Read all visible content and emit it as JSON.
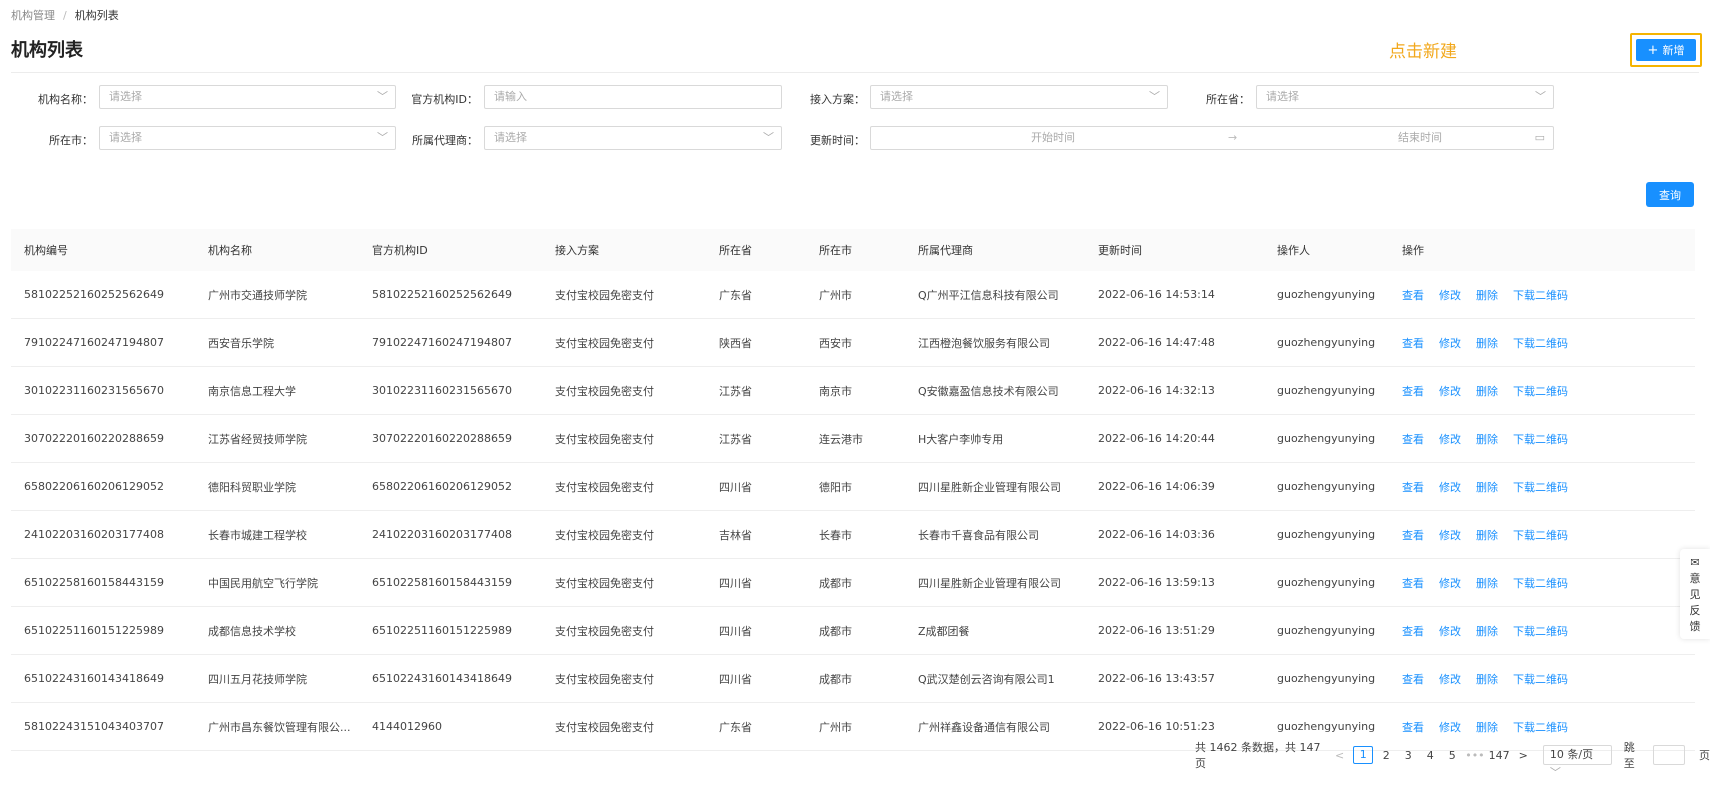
{
  "breadcrumb": {
    "parent": "机构管理",
    "separator": "/",
    "current": "机构列表"
  },
  "page_title": "机构列表",
  "hint_text": "点击新建",
  "add_button": "新增",
  "filters": {
    "org_name": {
      "label": "机构名称",
      "placeholder": "请选择"
    },
    "official_id": {
      "label": "官方机构ID",
      "placeholder": "请输入"
    },
    "access_plan": {
      "label": "接入方案",
      "placeholder": "请选择"
    },
    "province": {
      "label": "所在省",
      "placeholder": "请选择"
    },
    "city": {
      "label": "所在市",
      "placeholder": "请选择"
    },
    "agent": {
      "label": "所属代理商",
      "placeholder": "请选择"
    },
    "update_time": {
      "label": "更新时间",
      "start_placeholder": "开始时间",
      "end_placeholder": "结束时间",
      "separator": "→"
    }
  },
  "query_button": "查询",
  "table": {
    "columns": [
      "机构编号",
      "机构名称",
      "官方机构ID",
      "接入方案",
      "所在省",
      "所在市",
      "所属代理商",
      "更新时间",
      "操作人",
      "操作"
    ],
    "rows": [
      [
        "58102252160252562649",
        "广州市交通技师学院",
        "58102252160252562649",
        "支付宝校园免密支付",
        "广东省",
        "广州市",
        "Q广州平江信息科技有限公司",
        "2022-06-16 14:53:14",
        "guozhengyunying"
      ],
      [
        "79102247160247194807",
        "西安音乐学院",
        "79102247160247194807",
        "支付宝校园免密支付",
        "陕西省",
        "西安市",
        "江西橙泡餐饮服务有限公司",
        "2022-06-16 14:47:48",
        "guozhengyunying"
      ],
      [
        "30102231160231565670",
        "南京信息工程大学",
        "30102231160231565670",
        "支付宝校园免密支付",
        "江苏省",
        "南京市",
        "Q安徽嘉盈信息技术有限公司",
        "2022-06-16 14:32:13",
        "guozhengyunying"
      ],
      [
        "30702220160220288659",
        "江苏省经贸技师学院",
        "30702220160220288659",
        "支付宝校园免密支付",
        "江苏省",
        "连云港市",
        "H大客户李帅专用",
        "2022-06-16 14:20:44",
        "guozhengyunying"
      ],
      [
        "65802206160206129052",
        "德阳科贸职业学院",
        "65802206160206129052",
        "支付宝校园免密支付",
        "四川省",
        "德阳市",
        "四川星胜新企业管理有限公司",
        "2022-06-16 14:06:39",
        "guozhengyunying"
      ],
      [
        "24102203160203177408",
        "长春市城建工程学校",
        "24102203160203177408",
        "支付宝校园免密支付",
        "吉林省",
        "长春市",
        "长春市千喜食品有限公司",
        "2022-06-16 14:03:36",
        "guozhengyunying"
      ],
      [
        "65102258160158443159",
        "中国民用航空飞行学院",
        "65102258160158443159",
        "支付宝校园免密支付",
        "四川省",
        "成都市",
        "四川星胜新企业管理有限公司",
        "2022-06-16 13:59:13",
        "guozhengyunying"
      ],
      [
        "65102251160151225989",
        "成都信息技术学校",
        "65102251160151225989",
        "支付宝校园免密支付",
        "四川省",
        "成都市",
        "Z成都团餐",
        "2022-06-16 13:51:29",
        "guozhengyunying"
      ],
      [
        "65102243160143418649",
        "四川五月花技师学院",
        "65102243160143418649",
        "支付宝校园免密支付",
        "四川省",
        "成都市",
        "Q武汉楚创云咨询有限公司1",
        "2022-06-16 13:43:57",
        "guozhengyunying"
      ],
      [
        "58102243151043403707",
        "广州市昌东餐饮管理有限公...",
        "4144012960",
        "支付宝校园免密支付",
        "广东省",
        "广州市",
        "广州祥鑫设备通信有限公司",
        "2022-06-16 10:51:23",
        "guozhengyunying"
      ]
    ],
    "actions": [
      "查看",
      "修改",
      "删除",
      "下载二维码"
    ]
  },
  "pagination": {
    "summary": "共 1462 条数据，共 147 页",
    "prev": "<",
    "pages": [
      "1",
      "2",
      "3",
      "4",
      "5",
      "•••",
      "147"
    ],
    "next": ">",
    "page_size": "10 条/页",
    "jump_label": "跳至",
    "page_unit": "页"
  },
  "feedback": {
    "icon": "✉",
    "chars": [
      "意",
      "见",
      "反",
      "馈"
    ]
  }
}
